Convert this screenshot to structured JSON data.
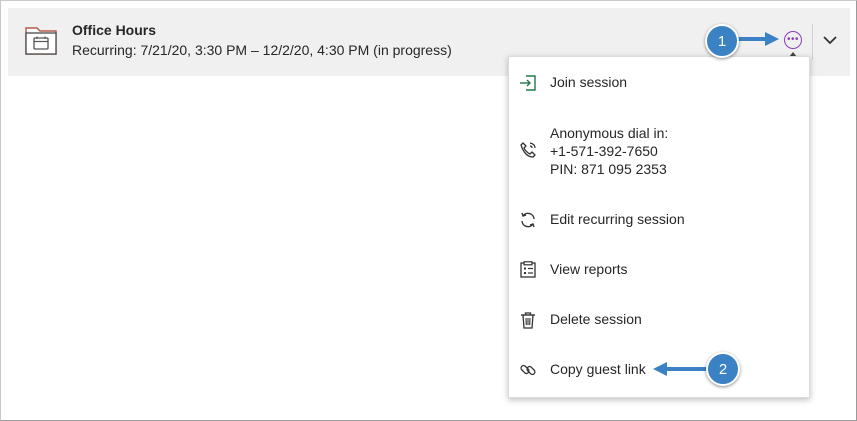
{
  "session": {
    "title": "Office Hours",
    "schedule": "Recurring: 7/21/20, 3:30 PM – 12/2/20, 4:30 PM (in progress)",
    "more_icon": "ellipsis-circle-icon",
    "expand_icon": "chevron-down-icon"
  },
  "menu": {
    "items": [
      {
        "label": "Join session",
        "icon": "join-icon"
      },
      {
        "label": "Anonymous dial in:",
        "line2": "+1-571-392-7650",
        "line3": "PIN: 871 095 2353",
        "icon": "phone-icon"
      },
      {
        "label": "Edit recurring session",
        "icon": "recurring-icon"
      },
      {
        "label": "View reports",
        "icon": "report-icon"
      },
      {
        "label": "Delete session",
        "icon": "trash-icon"
      },
      {
        "label": "Copy guest link",
        "icon": "link-icon"
      }
    ]
  },
  "callouts": {
    "first": "1",
    "second": "2"
  },
  "colors": {
    "accent_purple": "#8b3fb4",
    "callout_blue": "#3b82c4",
    "join_green": "#1f7a4a",
    "row_background": "#f0f0f0"
  }
}
